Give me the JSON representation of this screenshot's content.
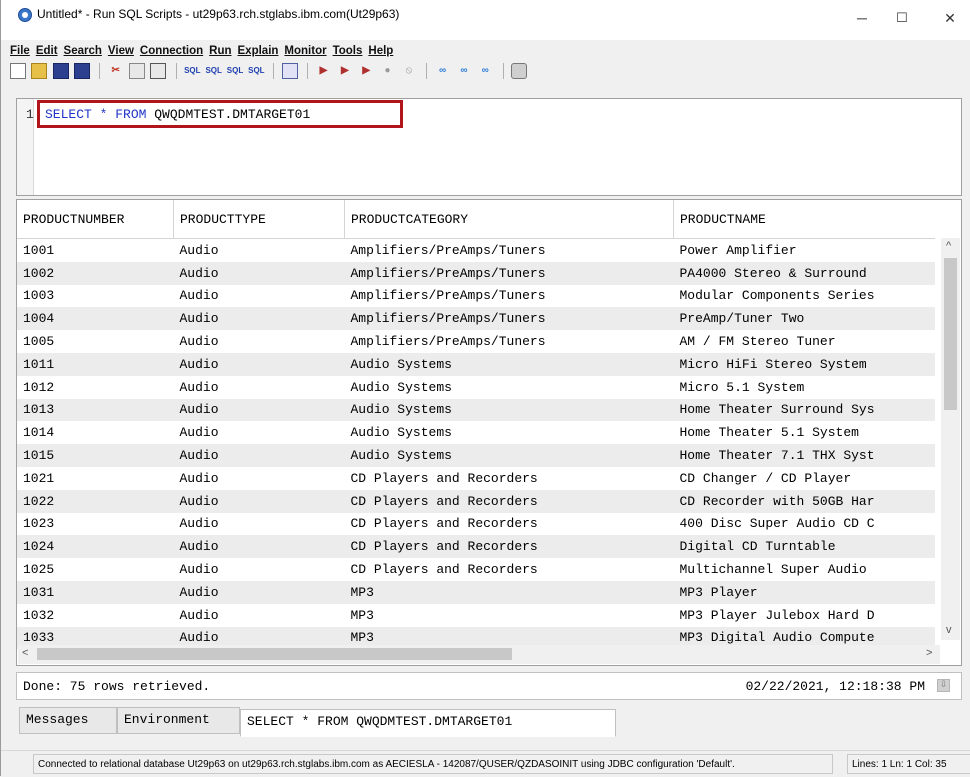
{
  "window": {
    "title": "Untitled* - Run SQL Scripts - ut29p63.rch.stglabs.ibm.com(Ut29p63)",
    "controls": {
      "minimize": "─",
      "maximize": "☐",
      "close": "✕"
    }
  },
  "menu": [
    "File",
    "Edit",
    "Search",
    "View",
    "Connection",
    "Run",
    "Explain",
    "Monitor",
    "Tools",
    "Help"
  ],
  "editor": {
    "line_number": "1",
    "sql_kw1": "SELECT",
    "sql_star": " * ",
    "sql_kw2": "FROM",
    "sql_table": " QWQDMTEST.DMTARGET01"
  },
  "results": {
    "columns": [
      "PRODUCTNUMBER",
      "PRODUCTTYPE",
      "PRODUCTCATEGORY",
      "PRODUCTNAME"
    ],
    "rows": [
      [
        "1001",
        "Audio",
        "Amplifiers/PreAmps/Tuners",
        "Power Amplifier"
      ],
      [
        "1002",
        "Audio",
        "Amplifiers/PreAmps/Tuners",
        "PA4000 Stereo & Surround"
      ],
      [
        "1003",
        "Audio",
        "Amplifiers/PreAmps/Tuners",
        "Modular Components Series"
      ],
      [
        "1004",
        "Audio",
        "Amplifiers/PreAmps/Tuners",
        "PreAmp/Tuner Two"
      ],
      [
        "1005",
        "Audio",
        "Amplifiers/PreAmps/Tuners",
        "AM / FM Stereo Tuner"
      ],
      [
        "1011",
        "Audio",
        "Audio Systems",
        "Micro HiFi Stereo System"
      ],
      [
        "1012",
        "Audio",
        "Audio Systems",
        "Micro 5.1 System"
      ],
      [
        "1013",
        "Audio",
        "Audio Systems",
        "Home Theater Surround Sys"
      ],
      [
        "1014",
        "Audio",
        "Audio Systems",
        "Home Theater 5.1 System"
      ],
      [
        "1015",
        "Audio",
        "Audio Systems",
        "Home Theater 7.1 THX Syst"
      ],
      [
        "1021",
        "Audio",
        "CD Players and Recorders",
        "CD Changer / CD Player"
      ],
      [
        "1022",
        "Audio",
        "CD Players and Recorders",
        "CD Recorder with 50GB Har"
      ],
      [
        "1023",
        "Audio",
        "CD Players and Recorders",
        "400 Disc Super Audio CD C"
      ],
      [
        "1024",
        "Audio",
        "CD Players and Recorders",
        "Digital CD Turntable"
      ],
      [
        "1025",
        "Audio",
        "CD Players and Recorders",
        "Multichannel Super Audio"
      ],
      [
        "1031",
        "Audio",
        "MP3",
        "MP3 Player"
      ],
      [
        "1032",
        "Audio",
        "MP3",
        "MP3 Player Julebox Hard D"
      ],
      [
        "1033",
        "Audio",
        "MP3",
        "MP3 Digital Audio Compute"
      ]
    ]
  },
  "status": {
    "done": "Done: 75 rows retrieved.",
    "timestamp": "02/22/2021, 12:18:38 PM"
  },
  "tabs": [
    "Messages",
    "Environment",
    "SELECT * FROM QWQDMTEST.DMTARGET01"
  ],
  "statusbar": {
    "connection": "Connected to relational database Ut29p63 on ut29p63.rch.stglabs.ibm.com as AECIESLA - 142087/QUSER/QZDASOINIT using JDBC configuration 'Default'.",
    "position": "Lines: 1 Ln: 1 Col: 35"
  },
  "colors": {
    "keyword": "#1f34c8",
    "highlight_border": "#b0151c"
  }
}
